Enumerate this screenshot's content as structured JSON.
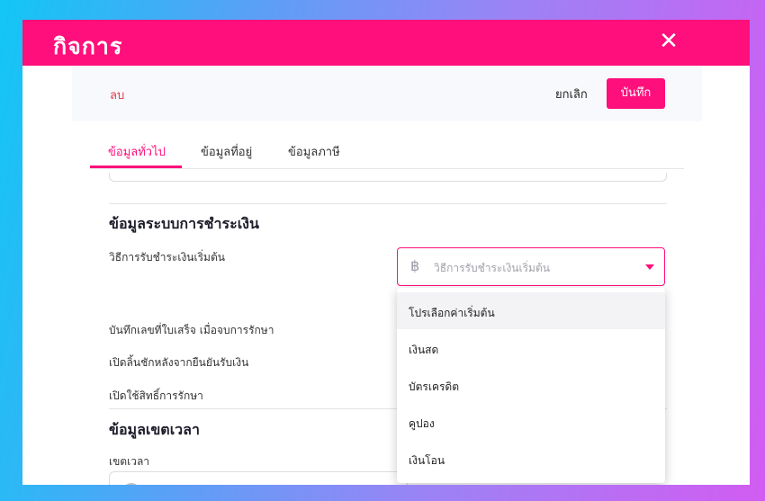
{
  "modal": {
    "title": "กิจการ",
    "close_glyph": "✕"
  },
  "actions": {
    "delete_label": "ลบ",
    "cancel_label": "ยกเลิก",
    "save_label": "บันทึก"
  },
  "tabs": [
    {
      "label": "ข้อมูลทั่วไป",
      "active": true
    },
    {
      "label": "ข้อมูลที่อยู่",
      "active": false
    },
    {
      "label": "ข้อมูลภาษี",
      "active": false
    }
  ],
  "payment_section": {
    "title": "ข้อมูลระบบการชำระเงิน",
    "default_method_label": "วิธีการรับชำระเงินเริ่มต้น",
    "default_method_placeholder": "วิธีการรับชำระเงินเริ่มต้น",
    "currency_icon": "฿",
    "receipt_label": "บันทึกเลขที่ใบเสร็จ เมื่อจบการรักษา",
    "drawer_label": "เปิดลิ้นชักหลังจากยืนยันรับเงิน",
    "rights_label": "เปิดใช้สิทธิ์การรักษา"
  },
  "dropdown_options": [
    {
      "label": "โปรเลือกค่าเริ่มต้น",
      "selected": true
    },
    {
      "label": "เงินสด",
      "selected": false
    },
    {
      "label": "บัตรเครดิต",
      "selected": false
    },
    {
      "label": "คูปอง",
      "selected": false
    },
    {
      "label": "เงินโอน",
      "selected": false
    }
  ],
  "timezone_section": {
    "title": "ข้อมูลเขตเวลา",
    "timezone_label": "เขตเวลา"
  },
  "colors": {
    "accent": "#ff0f7b",
    "danger": "#e0394a"
  }
}
